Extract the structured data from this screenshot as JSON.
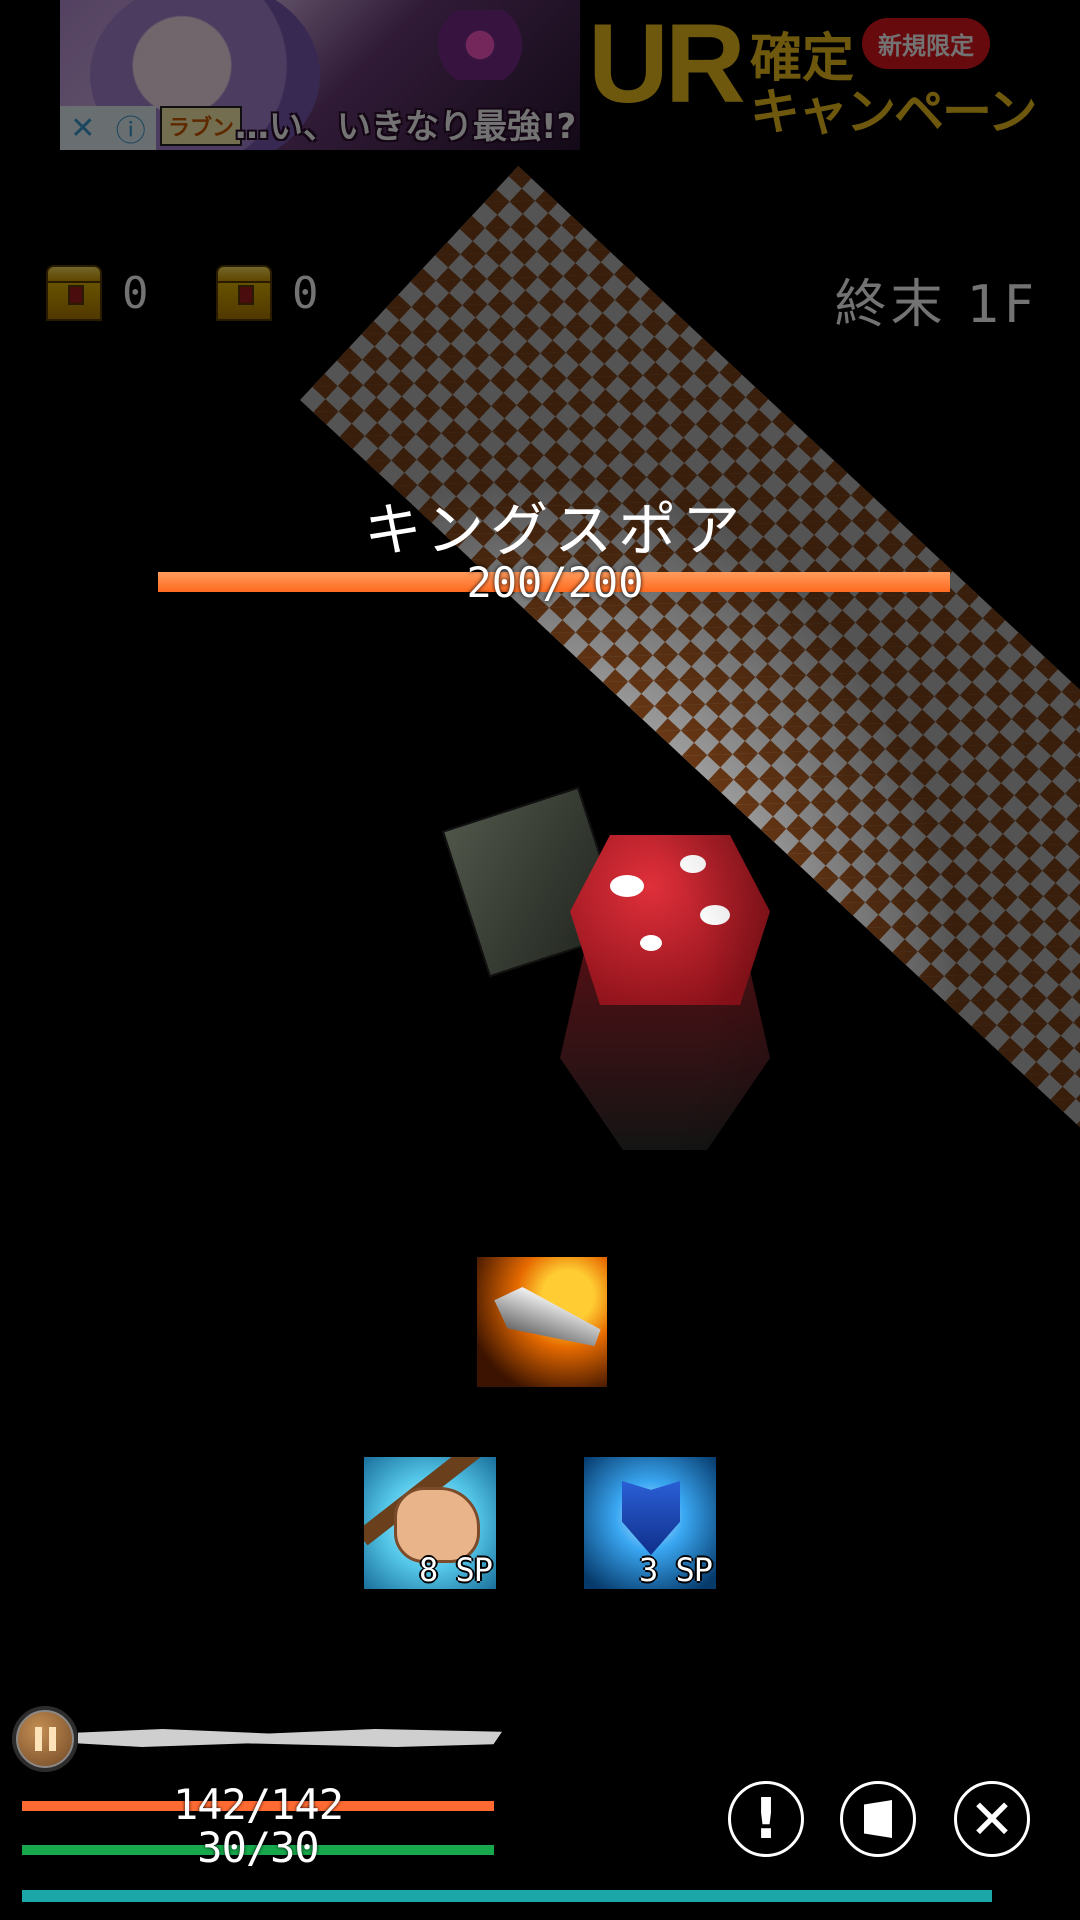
{
  "ad": {
    "brand": "ラブン",
    "tagline": "…い、いきなり最強!?",
    "headline_ur": "UR",
    "headline_kakutei": "確定",
    "headline_campaign": "キャンペーン",
    "badge": "新規限定",
    "close_glyph": "✕",
    "info_glyph": "ⓘ"
  },
  "hud": {
    "chest_gold_count": "0",
    "chest_red_count": "0",
    "floor": "終末 1F"
  },
  "enemy": {
    "name": "キングスポア",
    "hp_text": "200/200",
    "hp_fraction": 1.0
  },
  "skills": [
    {
      "name": "attack",
      "icon": "flaming-blade-icon"
    },
    {
      "name": "grip",
      "icon": "fist-icon",
      "cost": "8 SP"
    },
    {
      "name": "guard",
      "icon": "shield-icon",
      "cost": "3 SP"
    }
  ],
  "player": {
    "hp_text": "142/142",
    "hp_fraction": 1.0,
    "sp_text": "30/30",
    "sp_fraction": 1.0,
    "exp_fraction": 0.97,
    "floor_progress_fraction": 1.0
  },
  "buttons": {
    "info_glyph": "!",
    "battle_glyph": "✕"
  },
  "colors": {
    "enemy_hp": "#ff6a1f",
    "player_hp": "#ff6a32",
    "player_sp": "#16a84a",
    "exp": "#1ca6a8",
    "chest_gold": "#e6b800"
  }
}
